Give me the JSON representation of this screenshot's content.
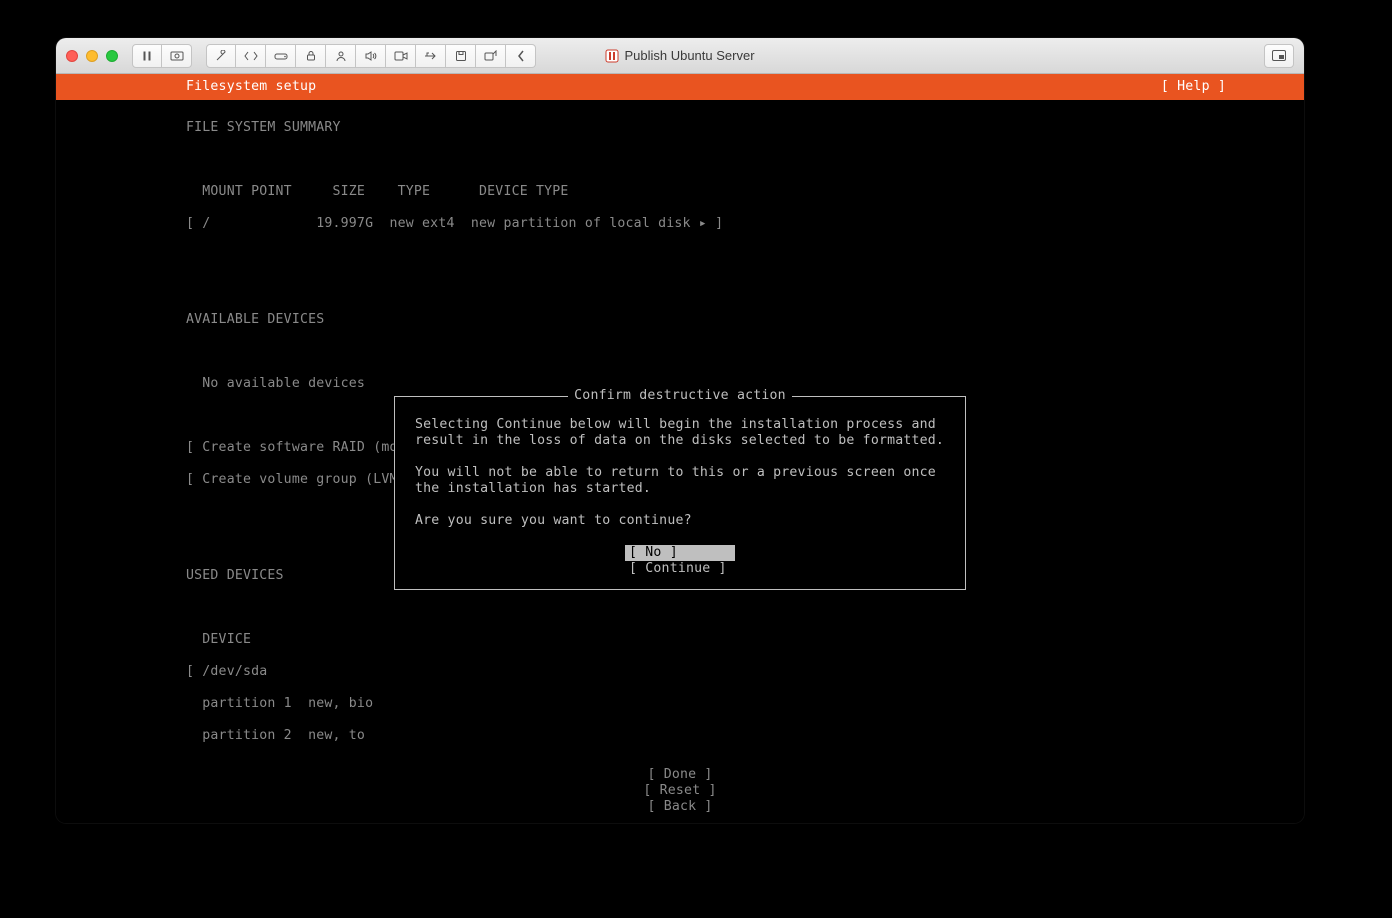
{
  "window": {
    "title": "Publish Ubuntu Server"
  },
  "header": {
    "title": "Filesystem setup",
    "help": "[ Help ]"
  },
  "summary": {
    "heading": "FILE SYSTEM SUMMARY",
    "columns": "  MOUNT POINT     SIZE    TYPE      DEVICE TYPE",
    "row": "[ /             19.997G  new ext4  new partition of local disk ▸ ]"
  },
  "available": {
    "heading": "AVAILABLE DEVICES",
    "none": "  No available devices",
    "raid": "[ Create software RAID (md) ▸ ]",
    "lvm": "[ Create volume group (LVM) ▸ ]"
  },
  "used": {
    "heading": "USED DEVICES",
    "col": "  DEVICE",
    "dev": "[ /dev/sda",
    "p1": "  partition 1  new, bio",
    "p2": "  partition 2  new, to"
  },
  "dialog": {
    "title": "Confirm destructive action",
    "para1": "Selecting Continue below will begin the installation process and result in the loss of data on the disks selected to be formatted.",
    "para2": "You will not be able to return to this or a previous screen once the installation has started.",
    "para3": "Are you sure you want to continue?",
    "no": "[ No         ]",
    "cont": "[ Continue   ]"
  },
  "footer": {
    "done": "[ Done       ]",
    "reset": "[ Reset      ]",
    "back": "[ Back       ]"
  }
}
